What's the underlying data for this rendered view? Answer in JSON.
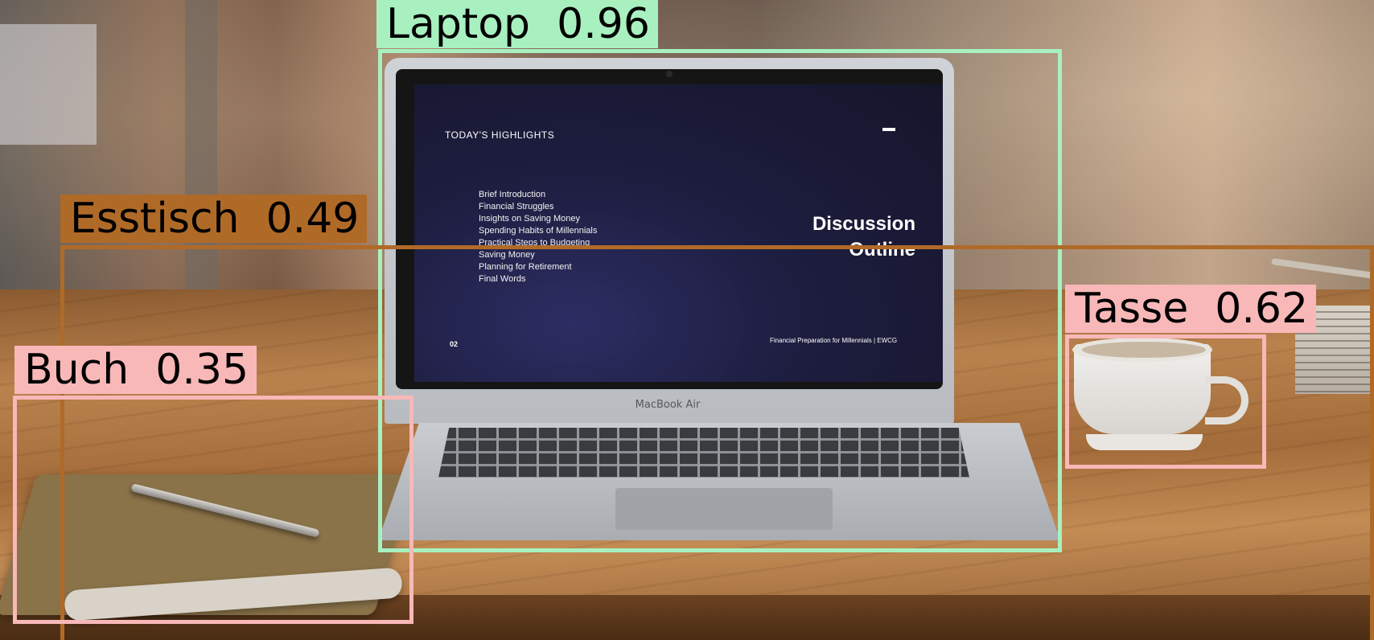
{
  "scene": {
    "screen": {
      "heading": "TODAY'S HIGHLIGHTS",
      "agenda": [
        "Brief Introduction",
        "Financial Struggles",
        "Insights on Saving Money",
        "Spending Habits of Millennials",
        "Practical Steps to Budgeting",
        "Saving Money",
        "Planning for Retirement",
        "Final Words"
      ],
      "title_line1": "Discussion",
      "title_line2": "Outline",
      "page_number": "02",
      "footer": "Financial Preparation for Millennials | EWCG"
    },
    "laptop_brand": "MacBook Air"
  },
  "detections": [
    {
      "label": "Laptop",
      "score": "0.96",
      "color": "#a8f0c0"
    },
    {
      "label": "Esstisch",
      "score": "0.49",
      "color": "#b06a28"
    },
    {
      "label": "Tasse",
      "score": "0.62",
      "color": "#f8b8b8"
    },
    {
      "label": "Buch",
      "score": "0.35",
      "color": "#f8b8b8"
    }
  ]
}
